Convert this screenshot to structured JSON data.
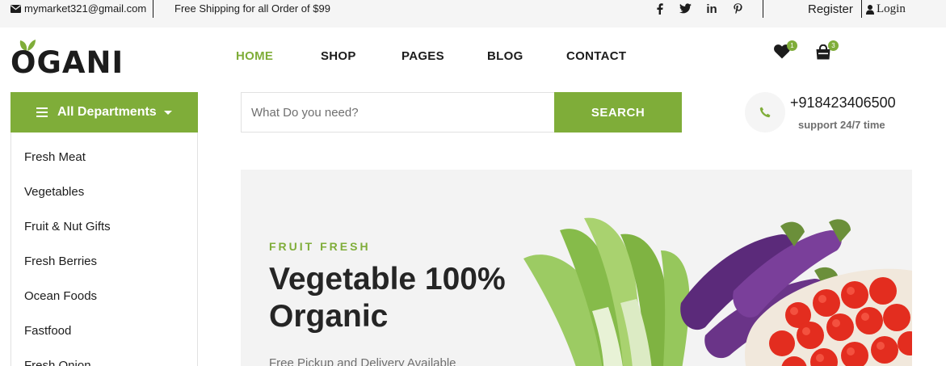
{
  "topbar": {
    "email": "mymarket321@gmail.com",
    "shipping": "Free Shipping for all Order of $99",
    "social": [
      "f",
      "twitter-icon",
      "in",
      "pinterest-icon"
    ],
    "register": "Register",
    "login": "Login"
  },
  "logo": {
    "text": "OGANI"
  },
  "nav": {
    "items": [
      "HOME",
      "SHOP",
      "PAGES",
      "BLOG",
      "CONTACT"
    ],
    "active": "HOME"
  },
  "cart": {
    "wishlist_count": "1",
    "bag_count": "3"
  },
  "departments": {
    "title": "All Departments",
    "items": [
      "Fresh Meat",
      "Vegetables",
      "Fruit & Nut Gifts",
      "Fresh Berries",
      "Ocean Foods",
      "Fastfood",
      "Fresh Onion"
    ]
  },
  "search": {
    "placeholder": "What Do you need?",
    "button": "SEARCH"
  },
  "phone": {
    "number": "+918423406500",
    "support": "support 24/7 time"
  },
  "hero": {
    "kicker": "FRUIT FRESH",
    "title": "Vegetable 100% Organic",
    "subtitle": "Free Pickup and Delivery Available"
  },
  "colors": {
    "accent": "#7fad39",
    "topbar_bg": "#f5f5f5",
    "text": "#1c1c1c"
  }
}
